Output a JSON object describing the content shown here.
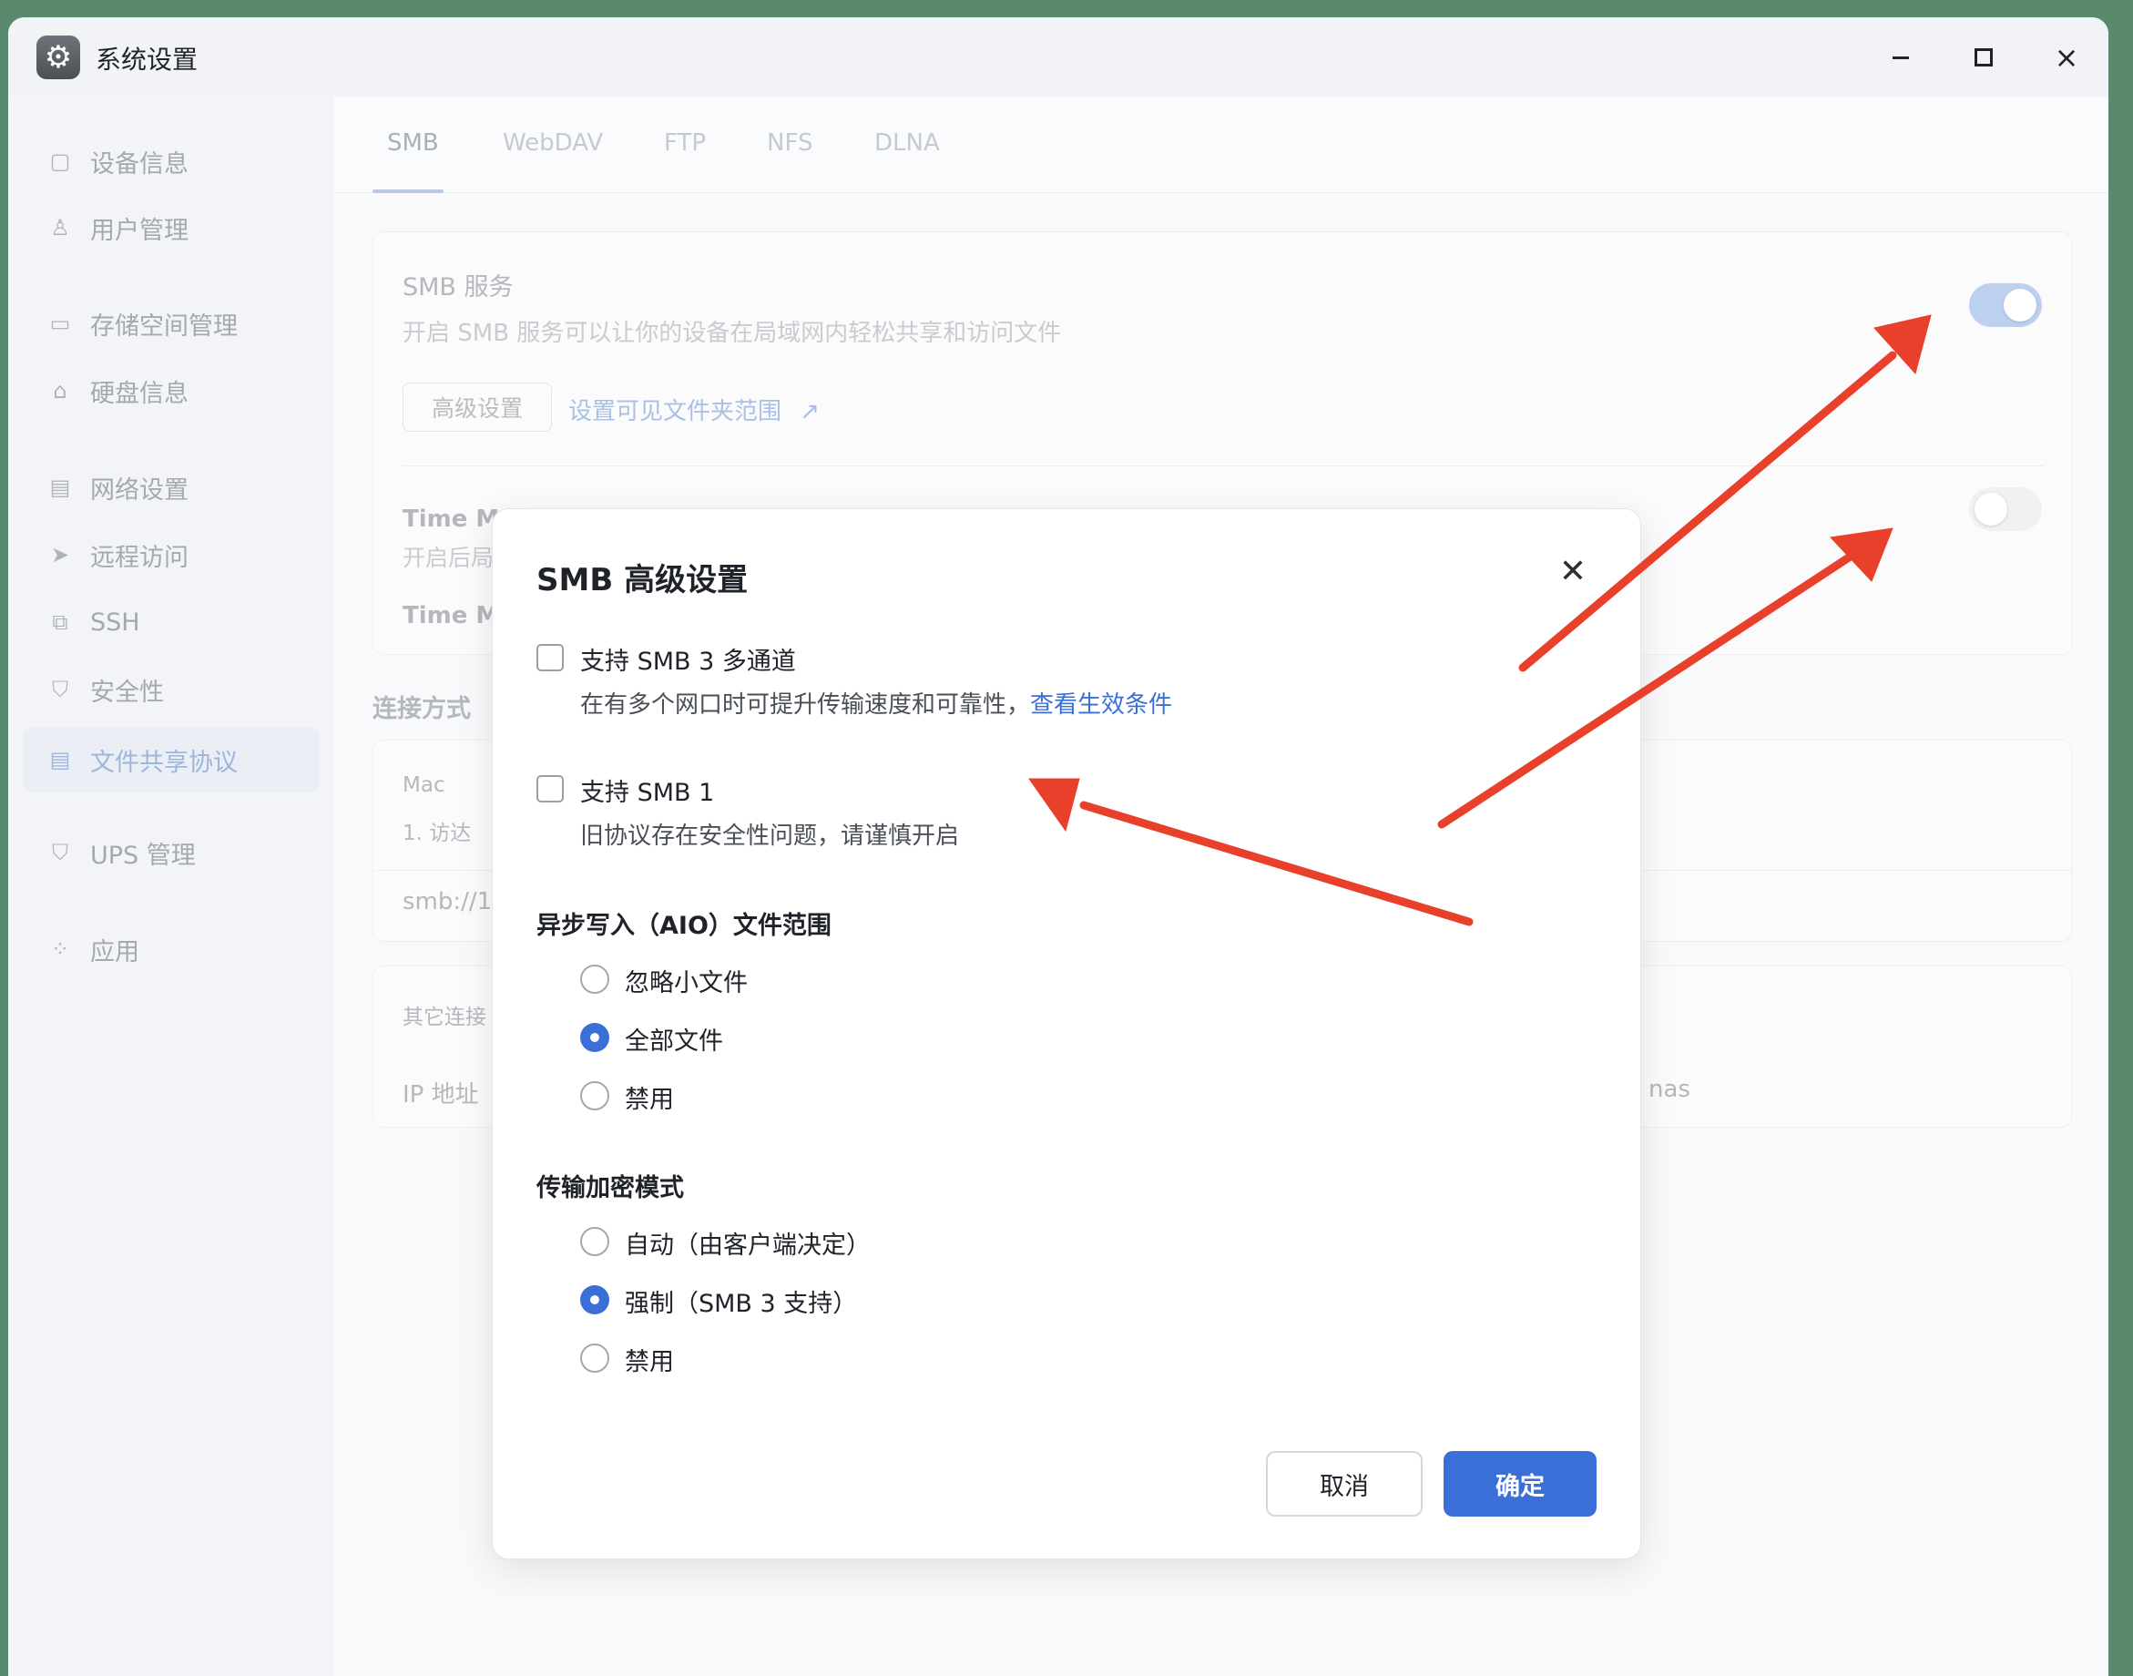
{
  "window": {
    "title": "系统设置",
    "app_icon": "gear-icon",
    "controls": {
      "minimize": "minimize-icon",
      "maximize": "maximize-icon",
      "close": "×"
    }
  },
  "sidebar": {
    "items": [
      {
        "label": "设备信息",
        "icon": "device-icon",
        "active": false
      },
      {
        "label": "用户管理",
        "icon": "user-icon",
        "active": false
      },
      {
        "label": "存储空间管理",
        "icon": "storage-icon",
        "active": false
      },
      {
        "label": "硬盘信息",
        "icon": "disk-icon",
        "active": false
      },
      {
        "label": "网络设置",
        "icon": "network-icon",
        "active": false
      },
      {
        "label": "远程访问",
        "icon": "remote-icon",
        "active": false
      },
      {
        "label": "SSH",
        "icon": "ssh-icon",
        "active": false
      },
      {
        "label": "安全性",
        "icon": "shield-icon",
        "active": false
      },
      {
        "label": "文件共享协议",
        "icon": "file-share-icon",
        "active": true
      },
      {
        "label": "UPS 管理",
        "icon": "ups-icon",
        "active": false
      },
      {
        "label": "应用",
        "icon": "apps-icon",
        "active": false
      }
    ]
  },
  "tabs": [
    {
      "label": "SMB",
      "active": true
    },
    {
      "label": "WebDAV",
      "active": false
    },
    {
      "label": "FTP",
      "active": false
    },
    {
      "label": "NFS",
      "active": false
    },
    {
      "label": "DLNA",
      "active": false
    }
  ],
  "smb_service": {
    "title": "SMB 服务",
    "description": "开启 SMB 服务可以让你的设备在局域网内轻松共享和访问文件",
    "advanced_button": "高级设置",
    "visible_folders_link": "设置可见文件夹范围",
    "enabled": true
  },
  "time_machine": {
    "title_partial": "Time M",
    "desc_partial": "开启后局",
    "sub_partial": "Time M",
    "enabled": false
  },
  "connection": {
    "section_label": "连接方式",
    "mac_label": "Mac",
    "mac_step": "1. 访达",
    "smb_url_partial": "smb://1",
    "other_label_partial": "其它连接",
    "ip_label_partial": "IP 地址",
    "hostname_partial": "nas"
  },
  "modal": {
    "title": "SMB 高级设置",
    "close": "✕",
    "multichannel": {
      "label": "支持 SMB 3 多通道",
      "desc": "在有多个网口时可提升传输速度和可靠性，",
      "link": "查看生效条件",
      "checked": false
    },
    "smb1": {
      "label": "支持 SMB 1",
      "desc": "旧协议存在安全性问题，请谨慎开启",
      "checked": false
    },
    "aio": {
      "label": "异步写入（AIO）文件范围",
      "options": [
        "忽略小文件",
        "全部文件",
        "禁用"
      ],
      "selected": 1
    },
    "encryption": {
      "label": "传输加密模式",
      "options": [
        "自动（由客户端决定）",
        "强制（SMB 3 支持）",
        "禁用"
      ],
      "selected": 1
    },
    "cancel": "取消",
    "confirm": "确定"
  },
  "colors": {
    "primary": "#3a6fd8",
    "annotation_arrow": "#e8402a",
    "background": "#5a8a6e"
  }
}
